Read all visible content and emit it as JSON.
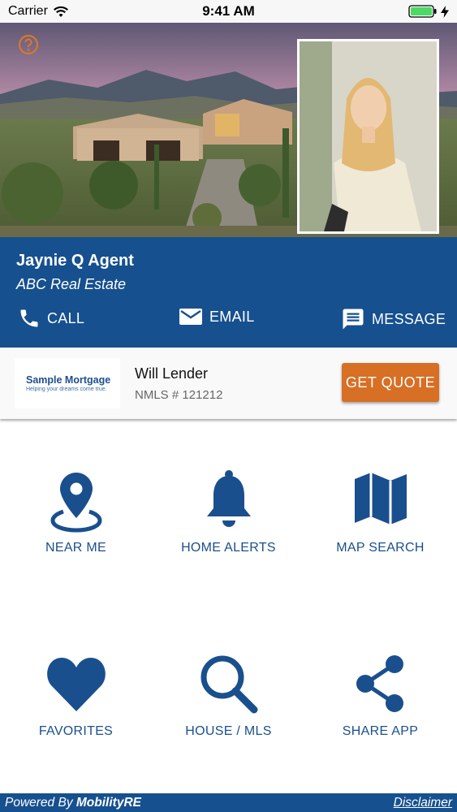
{
  "status_bar": {
    "carrier": "Carrier",
    "time": "9:41 AM"
  },
  "agent": {
    "name": "Jaynie Q Agent",
    "company": "ABC Real Estate"
  },
  "contact": {
    "call": "CALL",
    "email": "EMAIL",
    "message": "MESSAGE"
  },
  "lender": {
    "logo_name": "Sample Mortgage",
    "logo_tagline": "Helping your dreams come true.",
    "name": "Will Lender",
    "nmls": "NMLS # 121212",
    "quote_button": "GET QUOTE"
  },
  "tiles": [
    {
      "label": "NEAR ME",
      "icon": "location-pin-icon"
    },
    {
      "label": "HOME ALERTS",
      "icon": "bell-icon"
    },
    {
      "label": "MAP SEARCH",
      "icon": "map-icon"
    },
    {
      "label": "FAVORITES",
      "icon": "heart-icon"
    },
    {
      "label": "HOUSE / MLS",
      "icon": "search-icon"
    },
    {
      "label": "SHARE APP",
      "icon": "share-icon"
    }
  ],
  "footer": {
    "powered_prefix": "Powered By ",
    "brand": "MobilityRE",
    "disclaimer": "Disclaimer"
  },
  "colors": {
    "primary": "#16508f",
    "accent": "#d76f25",
    "icon_blue": "#1a4f8e"
  }
}
